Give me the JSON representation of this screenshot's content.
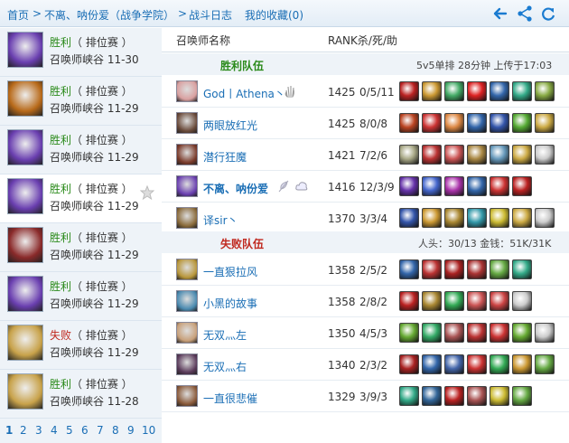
{
  "breadcrumb": [
    "首页",
    ">",
    "不离、呐份爱（战争学院）",
    ">",
    "战斗日志",
    "我的收藏(0)"
  ],
  "list_header": {
    "name": "召唤师名称",
    "stats": "RANK杀/死/助"
  },
  "matches": [
    {
      "result": "胜利",
      "type": "（ 排位赛 ）",
      "map": "召唤师峡谷 11-30",
      "win": true,
      "av": "#6a3fb0"
    },
    {
      "result": "胜利",
      "type": "（ 排位赛 ）",
      "map": "召唤师峡谷 11-29",
      "win": true,
      "av": "#b86a1a"
    },
    {
      "result": "胜利",
      "type": "（ 排位赛 ）",
      "map": "召唤师峡谷 11-29",
      "win": true,
      "av": "#6a3fb0"
    },
    {
      "result": "胜利",
      "type": "（ 排位赛 ）",
      "map": "召唤师峡谷 11-29",
      "win": true,
      "av": "#6a3fb0"
    },
    {
      "result": "胜利",
      "type": "（ 排位赛 ）",
      "map": "召唤师峡谷 11-29",
      "win": true,
      "av": "#8a2a2a"
    },
    {
      "result": "胜利",
      "type": "（ 排位赛 ）",
      "map": "召唤师峡谷 11-29",
      "win": true,
      "av": "#6a3fb0"
    },
    {
      "result": "失败",
      "type": "（ 排位赛 ）",
      "map": "召唤师峡谷 11-29",
      "win": false,
      "av": "#c8a24a"
    },
    {
      "result": "胜利",
      "type": "（ 排位赛 ）",
      "map": "召唤师峡谷 11-28",
      "win": true,
      "av": "#c8a24a"
    }
  ],
  "pages": [
    "1",
    "2",
    "3",
    "4",
    "5",
    "6",
    "7",
    "8",
    "9",
    "10"
  ],
  "win_team": {
    "label": "胜利队伍",
    "info": "5v5单排 28分钟 上传于17:03"
  },
  "lose_team": {
    "label": "失败队伍",
    "info": "人头：30/13 金钱：51K/31K"
  },
  "win_players": [
    {
      "name": "God丨Athena丶",
      "rank": "1425",
      "kda": "0/5/11",
      "av": "#d9a0a0",
      "items": [
        "#b22",
        "#c93",
        "#4a6",
        "#d22",
        "#36a",
        "#3a8",
        "#8a4"
      ],
      "me": false
    },
    {
      "name": "两眼放红光",
      "rank": "1425",
      "kda": "8/0/8",
      "av": "#6a4a3a",
      "items": [
        "#b42",
        "#c33",
        "#d84",
        "#36a",
        "#35a",
        "#5a3",
        "#ca4"
      ],
      "me": false
    },
    {
      "name": "潜行狂魔",
      "rank": "1421",
      "kda": "7/2/6",
      "av": "#7a3a2a",
      "items": [
        "#aa8",
        "#b33",
        "#c55",
        "#a84",
        "#69b",
        "#ca4",
        "#ccc"
      ],
      "me": false
    },
    {
      "name": "不离、呐份爱",
      "rank": "1416",
      "kda": "12/3/9",
      "av": "#6a3fb0",
      "items": [
        "#63a",
        "#46c",
        "#a3a",
        "#36a",
        "#c33",
        "#b22"
      ],
      "me": true
    },
    {
      "name": "译sir丶",
      "rank": "1370",
      "kda": "3/3/4",
      "av": "#8a6a3a",
      "items": [
        "#35a",
        "#c93",
        "#a83",
        "#39a",
        "#cb3",
        "#ca4",
        "#ccc"
      ],
      "me": false
    }
  ],
  "lose_players": [
    {
      "name": "一直狠拉风",
      "rank": "1358",
      "kda": "2/5/2",
      "av": "#b8963a",
      "items": [
        "#36a",
        "#b33",
        "#a22",
        "#a33",
        "#6a4",
        "#3a8"
      ],
      "me": false
    },
    {
      "name": "小黑的故事",
      "rank": "1358",
      "kda": "2/8/2",
      "av": "#4a8ab0",
      "items": [
        "#b22",
        "#a83",
        "#3a5",
        "#c55",
        "#c44",
        "#ccc"
      ],
      "me": false
    },
    {
      "name": "无双灬左",
      "rank": "1350",
      "kda": "4/5/3",
      "av": "#c8a07a",
      "items": [
        "#6a3",
        "#3a6",
        "#a55",
        "#b33",
        "#c33",
        "#6a3",
        "#ccc"
      ],
      "me": false
    },
    {
      "name": "无双灬右",
      "rank": "1340",
      "kda": "2/3/2",
      "av": "#5a3a5a",
      "items": [
        "#a22",
        "#36a",
        "#46a",
        "#c33",
        "#3a5",
        "#c93",
        "#6a4"
      ],
      "me": false
    },
    {
      "name": "一直很悲催",
      "rank": "1329",
      "kda": "3/9/3",
      "av": "#8a5a3a",
      "items": [
        "#3a8",
        "#369",
        "#b22",
        "#a55",
        "#cb3",
        "#6a4"
      ],
      "me": false
    }
  ],
  "icons": {
    "back": "back-arrow-icon",
    "share": "share-icon",
    "refresh": "refresh-icon",
    "star": "star-icon"
  }
}
